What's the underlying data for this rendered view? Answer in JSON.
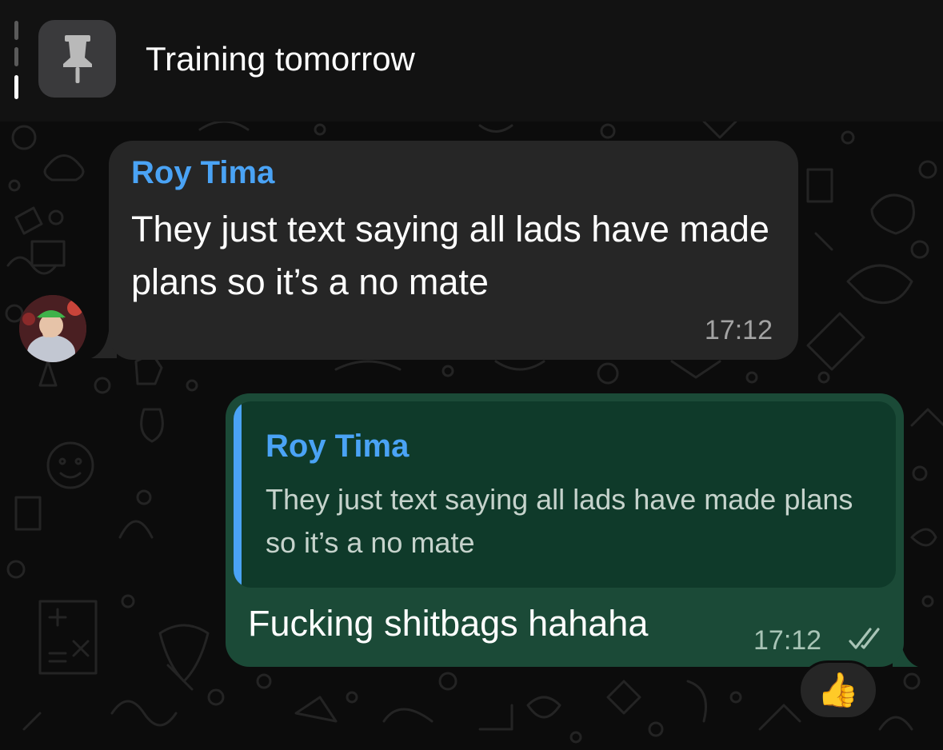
{
  "pinned": {
    "title": "Training tomorrow",
    "icon": "pin-icon"
  },
  "messages": [
    {
      "direction": "incoming",
      "sender": "Roy Tima",
      "text": "They just text saying all lads have made plans so it’s a no mate",
      "time": "17:12",
      "avatar": "avatar"
    },
    {
      "direction": "outgoing",
      "quote": {
        "sender": "Roy Tima",
        "text": "They just text saying all lads have made plans so it’s a no mate"
      },
      "text": "Fucking shitbags hahaha",
      "time": "17:12",
      "status_icon": "double-check-icon",
      "reaction": "👍"
    }
  ],
  "colors": {
    "sender_name": "#4aa3f5",
    "incoming_bubble": "#262626",
    "outgoing_bubble": "#1b4a37",
    "quote_background": "#0f3a2a"
  }
}
